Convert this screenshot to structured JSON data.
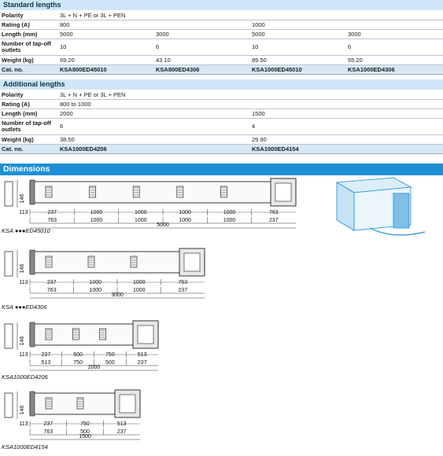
{
  "standard": {
    "title": "Standard lengths",
    "rows": [
      {
        "label": "Polarity",
        "cells": [
          "3L + N + PE or 3L + PEN",
          "",
          "",
          ""
        ]
      },
      {
        "label": "Rating (A)",
        "cells": [
          "800",
          "",
          "1000",
          ""
        ]
      },
      {
        "label": "Length (mm)",
        "cells": [
          "5000",
          "3000",
          "5000",
          "3000"
        ]
      },
      {
        "label": "Number of tap-off outlets",
        "cells": [
          "10",
          "6",
          "10",
          "6"
        ]
      },
      {
        "label": "Weight (kg)",
        "cells": [
          "69.20",
          "43.10",
          "89.50",
          "55.20"
        ]
      },
      {
        "label": "Cat. no.",
        "cells": [
          "KSA800ED45010",
          "KSA800ED4306",
          "KSA1000ED45010",
          "KSA1000ED4306"
        ]
      }
    ]
  },
  "additional": {
    "title": "Additional lengths",
    "rows": [
      {
        "label": "Polarity",
        "cells": [
          "3L + N + PE or 3L + PEN",
          ""
        ]
      },
      {
        "label": "Rating (A)",
        "cells": [
          "800 to 1000",
          ""
        ]
      },
      {
        "label": "Length (mm)",
        "cells": [
          "2000",
          "1500"
        ]
      },
      {
        "label": "Number of tap-off outlets",
        "cells": [
          "6",
          "4"
        ]
      },
      {
        "label": "Weight (kg)",
        "cells": [
          "38.50",
          "29.90"
        ]
      },
      {
        "label": "Cat. no.",
        "cells": [
          "KSA1000ED4206",
          "KSA1000ED4154"
        ]
      }
    ]
  },
  "dimensions": {
    "title": "Dimensions",
    "drawings": [
      {
        "caption": "KSA ●●●ED45010",
        "height": "146",
        "side": "113",
        "top": [
          "237",
          "1000",
          "1000",
          "1000",
          "1000",
          "763"
        ],
        "bottom": [
          "763",
          "1000",
          "1000",
          "1000",
          "1000",
          "237"
        ],
        "total": "5000"
      },
      {
        "caption": "KSA ●●●ED4306",
        "height": "146",
        "side": "113",
        "top": [
          "237",
          "1000",
          "1000",
          "763"
        ],
        "bottom": [
          "763",
          "1000",
          "1000",
          "237"
        ],
        "total": "3000"
      },
      {
        "caption": "KSA1000ED4206",
        "height": "146",
        "side": "113",
        "top": [
          "237",
          "500",
          "750",
          "513"
        ],
        "bottom": [
          "513",
          "750",
          "500",
          "237"
        ],
        "total": "2000"
      },
      {
        "caption": "KSA1000ED4154",
        "height": "146",
        "side": "113",
        "top": [
          "237",
          "750",
          "513"
        ],
        "bottom": [
          "763",
          "500",
          "237"
        ],
        "total": "1500"
      }
    ]
  }
}
